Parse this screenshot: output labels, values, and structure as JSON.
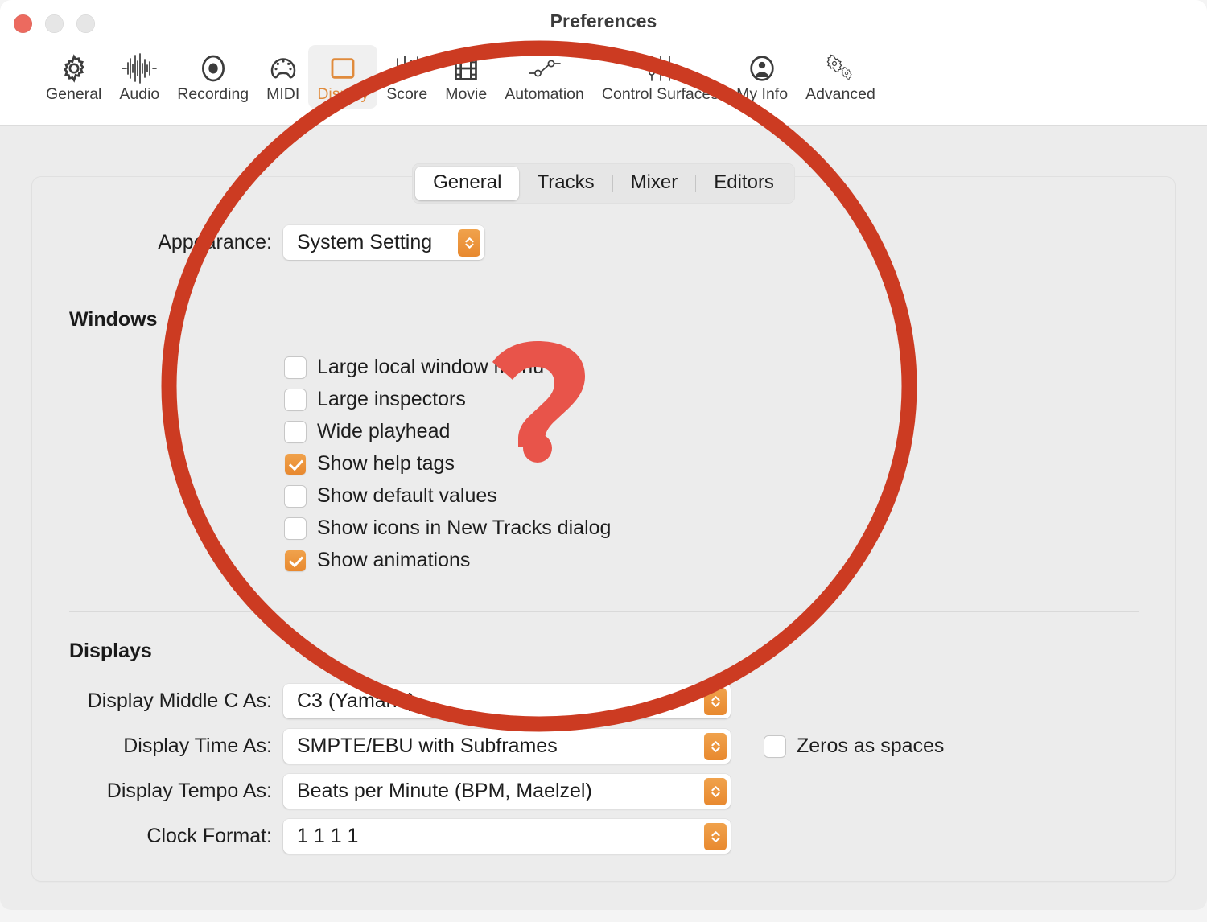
{
  "window": {
    "title": "Preferences",
    "traffic_lights": [
      {
        "name": "close",
        "color": "#ec6a5f"
      },
      {
        "name": "minimize",
        "color": "#e6e6e6"
      },
      {
        "name": "zoom",
        "color": "#e6e6e6"
      }
    ]
  },
  "toolbar": {
    "selected": "Display",
    "items": [
      {
        "label": "General",
        "icon": "gear-icon"
      },
      {
        "label": "Audio",
        "icon": "waveform-icon"
      },
      {
        "label": "Recording",
        "icon": "record-circle-icon"
      },
      {
        "label": "MIDI",
        "icon": "midi-connector-icon"
      },
      {
        "label": "Display",
        "icon": "display-rectangle-icon"
      },
      {
        "label": "Score",
        "icon": "music-notes-icon"
      },
      {
        "label": "Movie",
        "icon": "film-strip-icon"
      },
      {
        "label": "Automation",
        "icon": "automation-nodes-icon"
      },
      {
        "label": "Control Surfaces",
        "icon": "sliders-icon"
      },
      {
        "label": "My Info",
        "icon": "person-circle-icon"
      },
      {
        "label": "Advanced",
        "icon": "double-gear-icon"
      }
    ]
  },
  "tabs": {
    "active": "General",
    "items": [
      "General",
      "Tracks",
      "Mixer",
      "Editors"
    ]
  },
  "appearance": {
    "label": "Appearance:",
    "value": "System Setting"
  },
  "windows_section": {
    "heading": "Windows",
    "checkboxes": [
      {
        "label": "Large local window menu",
        "checked": false
      },
      {
        "label": "Large inspectors",
        "checked": false
      },
      {
        "label": "Wide playhead",
        "checked": false
      },
      {
        "label": "Show help tags",
        "checked": true
      },
      {
        "label": "Show default values",
        "checked": false
      },
      {
        "label": "Show icons in New Tracks dialog",
        "checked": false
      },
      {
        "label": "Show animations",
        "checked": true
      }
    ]
  },
  "displays_section": {
    "heading": "Displays",
    "rows": [
      {
        "label": "Display Middle C As:",
        "value": "C3 (Yamaha)"
      },
      {
        "label": "Display Time As:",
        "value": "SMPTE/EBU with Subframes"
      },
      {
        "label": "Display Tempo As:",
        "value": "Beats per Minute (BPM, Maelzel)"
      },
      {
        "label": "Clock Format:",
        "value": "1 1 1 1"
      }
    ],
    "zeros_as_spaces": {
      "label": "Zeros as spaces",
      "checked": false
    }
  },
  "annotation": {
    "circle_color": "#cc3b22",
    "question_mark_color": "#e8544a",
    "question_mark": "?"
  },
  "colors": {
    "accent_orange": "#e8892f",
    "selected_tab_text": "#e08b3c",
    "panel_bg": "#ececec",
    "chrome_bg": "#ffffff"
  }
}
